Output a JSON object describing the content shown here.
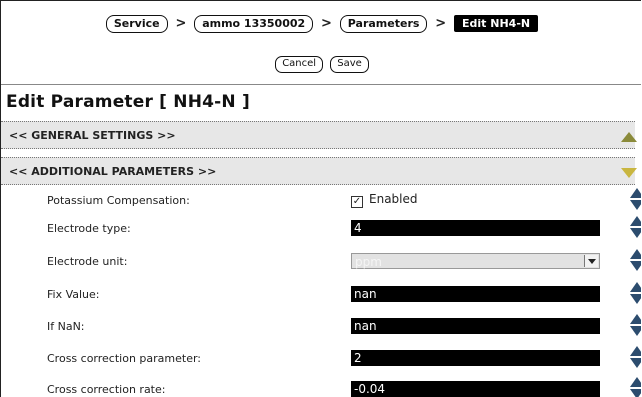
{
  "breadcrumb": {
    "items": [
      "Service",
      "ammo 13350002",
      "Parameters"
    ],
    "current": "Edit NH4-N",
    "separator": ">"
  },
  "actions": {
    "cancel": "Cancel",
    "save": "Save"
  },
  "page_title": "Edit Parameter [ NH4-N ]",
  "sections": {
    "general": "<<  GENERAL SETTINGS  >>",
    "additional": "<<  ADDITIONAL PARAMETERS  >>"
  },
  "fields": {
    "potassium": {
      "label": "Potassium Compensation:",
      "value": "Enabled",
      "checked": true,
      "check_glyph": "✓"
    },
    "electrode_type": {
      "label": "Electrode type:",
      "value": "4"
    },
    "electrode_unit": {
      "label": "Electrode unit:",
      "value": "ppm"
    },
    "fix_value": {
      "label": "Fix Value:",
      "value": "nan"
    },
    "if_nan": {
      "label": "If NaN:",
      "value": "nan"
    },
    "cross_param": {
      "label": "Cross correction parameter:",
      "value": "2"
    },
    "cross_rate": {
      "label": "Cross correction rate:",
      "value": "-0.04"
    }
  }
}
